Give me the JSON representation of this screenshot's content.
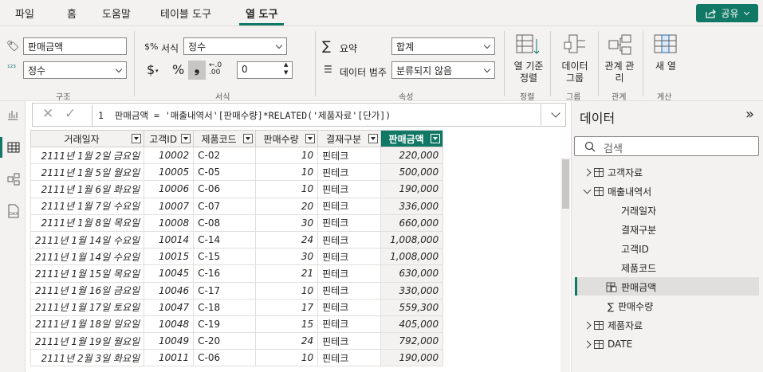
{
  "tabs": [
    {
      "label": "파일"
    },
    {
      "label": "홈"
    },
    {
      "label": "도움말"
    },
    {
      "label": "테이블 도구"
    },
    {
      "label": "열 도구"
    }
  ],
  "share": {
    "label": "공유"
  },
  "ribbon": {
    "name_value": "판매금액",
    "datatype_value": "정수",
    "structure_group": "구조",
    "format_label": "서식",
    "format_value": "정수",
    "decimals_value": "0",
    "format_group": "서식",
    "summary_label": "요약",
    "summary_value": "합계",
    "category_label": "데이터 범주",
    "category_value": "분류되지 않음",
    "properties_group": "속성",
    "sort_label": "열 기준 정렬",
    "sort_group": "정렬",
    "groups_label": "데이터 그룹",
    "groups_group": "그룹",
    "relationships_label": "관계 관리",
    "relationships_group": "관계",
    "new_column_label": "새 열",
    "calculations_group": "계산"
  },
  "formula": {
    "line": "1",
    "text": "판매금액 = '매출내역서'[판매수량]*RELATED('제품자료'[단가])"
  },
  "table": {
    "columns": [
      "거래일자",
      "고객ID",
      "제품코드",
      "판매수량",
      "결재구분",
      "판매금액"
    ],
    "rows": [
      [
        "2111년 1월 2일 금요일",
        "10002",
        "C-02",
        "10",
        "핀테크",
        "220,000"
      ],
      [
        "2111년 1월 5일 월요일",
        "10005",
        "C-05",
        "10",
        "핀테크",
        "500,000"
      ],
      [
        "2111년 1월 6일 화요일",
        "10006",
        "C-06",
        "10",
        "핀테크",
        "190,000"
      ],
      [
        "2111년 1월 7일 수요일",
        "10007",
        "C-07",
        "20",
        "핀테크",
        "336,000"
      ],
      [
        "2111년 1월 8일 목요일",
        "10008",
        "C-08",
        "30",
        "핀테크",
        "660,000"
      ],
      [
        "2111년 1월 14일 수요일",
        "10014",
        "C-14",
        "24",
        "핀테크",
        "1,008,000"
      ],
      [
        "2111년 1월 14일 수요일",
        "10015",
        "C-15",
        "30",
        "핀테크",
        "1,008,000"
      ],
      [
        "2111년 1월 15일 목요일",
        "10045",
        "C-16",
        "21",
        "핀테크",
        "630,000"
      ],
      [
        "2111년 1월 16일 금요일",
        "10046",
        "C-17",
        "10",
        "핀테크",
        "330,000"
      ],
      [
        "2111년 1월 17일 토요일",
        "10047",
        "C-18",
        "17",
        "핀테크",
        "559,300"
      ],
      [
        "2111년 1월 18일 일요일",
        "10048",
        "C-19",
        "15",
        "핀테크",
        "405,000"
      ],
      [
        "2111년 1월 19일 월요일",
        "10049",
        "C-20",
        "24",
        "핀테크",
        "792,000"
      ],
      [
        "2111년 2월 3일 화요일",
        "10011",
        "C-06",
        "10",
        "핀테크",
        "190,000"
      ]
    ]
  },
  "data_panel": {
    "title": "데이터",
    "search_placeholder": "검색",
    "tables": [
      {
        "name": "고객자료"
      },
      {
        "name": "매출내역서",
        "fields": [
          "거래일자",
          "결재구분",
          "고객ID",
          "제품코드",
          "판매금액",
          "판매수량"
        ]
      },
      {
        "name": "제품자료"
      },
      {
        "name": "DATE"
      }
    ]
  },
  "colors": {
    "accent": "#117865"
  }
}
